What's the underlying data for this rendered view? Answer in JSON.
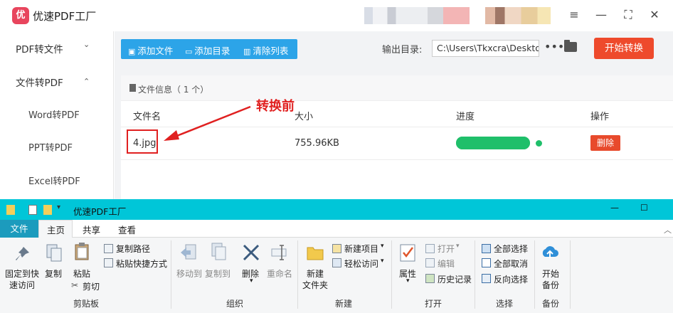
{
  "app": {
    "logo_text": "优",
    "title": "优速PDF工厂",
    "window_buttons": [
      "≡",
      "—",
      "⛶",
      "✕"
    ]
  },
  "sidebar": {
    "items": [
      {
        "label": "PDF转文件",
        "arrow": "⌄"
      },
      {
        "label": "文件转PDF",
        "arrow": "⌃"
      }
    ],
    "sub_items": [
      "Word转PDF",
      "PPT转PDF",
      "Excel转PDF"
    ]
  },
  "toolbar": {
    "add_file": "添加文件",
    "add_folder": "添加目录",
    "clear_list": "清除列表",
    "output_label": "输出目录:",
    "output_path": "C:\\Users\\Tkxcra\\Desktop",
    "more": "•••",
    "start": "开始转换"
  },
  "table": {
    "file_info": "文件信息（ 1 个）",
    "headers": {
      "name": "文件名",
      "size": "大小",
      "progress": "进度",
      "action": "操作"
    },
    "rows": [
      {
        "name": "4.jpg",
        "size": "755.96KB",
        "progress": 1.0,
        "action": "删除"
      }
    ]
  },
  "annotation": {
    "text": "转换前",
    "color": "#e02020"
  },
  "explorer": {
    "title": "优速PDF工厂",
    "window_buttons": [
      "—",
      "☐"
    ],
    "tabs": [
      "文件",
      "主页",
      "共享",
      "查看"
    ],
    "clipboard": {
      "pin": [
        "固定到快",
        "速访问"
      ],
      "copy": "复制",
      "paste": "粘贴",
      "copy_path": "复制路径",
      "paste_shortcut": "粘贴快捷方式",
      "cut": "剪切",
      "group": "剪贴板"
    },
    "organize": {
      "move_to": "移动到",
      "copy_to": "复制到",
      "delete": "删除",
      "rename": "重命名",
      "group": "组织"
    },
    "new": {
      "new_folder": [
        "新建",
        "文件夹"
      ],
      "new_item": "新建项目",
      "easy_access": "轻松访问",
      "group": "新建"
    },
    "open": {
      "properties": "属性",
      "open": "打开",
      "edit": "编辑",
      "history": "历史记录",
      "group": "打开"
    },
    "select": {
      "select_all": "全部选择",
      "select_none": "全部取消",
      "invert": "反向选择",
      "group": "选择"
    },
    "backup": {
      "start_backup": [
        "开始",
        "备份"
      ],
      "group": "备份"
    }
  },
  "colors": {
    "accent_blue": "#2ca4e8",
    "start_red": "#ee4a2c",
    "progress_green": "#1fbf6a",
    "explorer_title": "#00c6d8",
    "file_tab": "#1c9bbd"
  }
}
